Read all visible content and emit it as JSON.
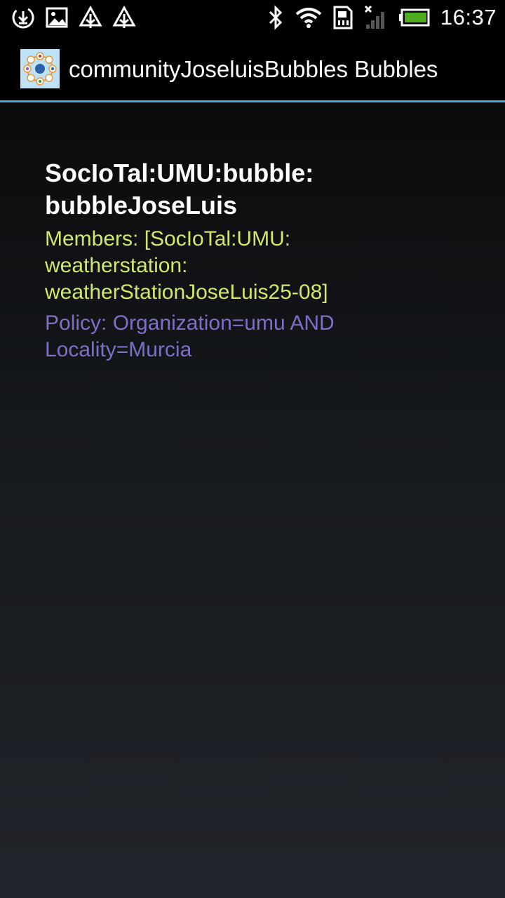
{
  "status_bar": {
    "time": "16:37",
    "left_icons": [
      "download-icon",
      "image-icon",
      "tree-icon",
      "tree-icon"
    ],
    "right_icons": [
      "bluetooth-icon",
      "wifi-icon",
      "sim-icon",
      "no-signal-icon",
      "battery-icon"
    ]
  },
  "action_bar": {
    "title": "communityJoseluisBubbles Bubbles",
    "accent_color": "#4fa6d8",
    "app_icon": "bubbles-app-icon"
  },
  "bubble": {
    "name": "SocIoTal:UMU:bubble:\nbubbleJoseLuis",
    "members": "Members: [SocIoTal:UMU:\nweatherstation:\nweatherStationJoseLuis25-08]",
    "policy": "Policy: Organization=umu AND\nLocality=Murcia",
    "name_color": "#ffffff",
    "members_color": "#d2e869",
    "policy_color": "#7b70c6"
  }
}
